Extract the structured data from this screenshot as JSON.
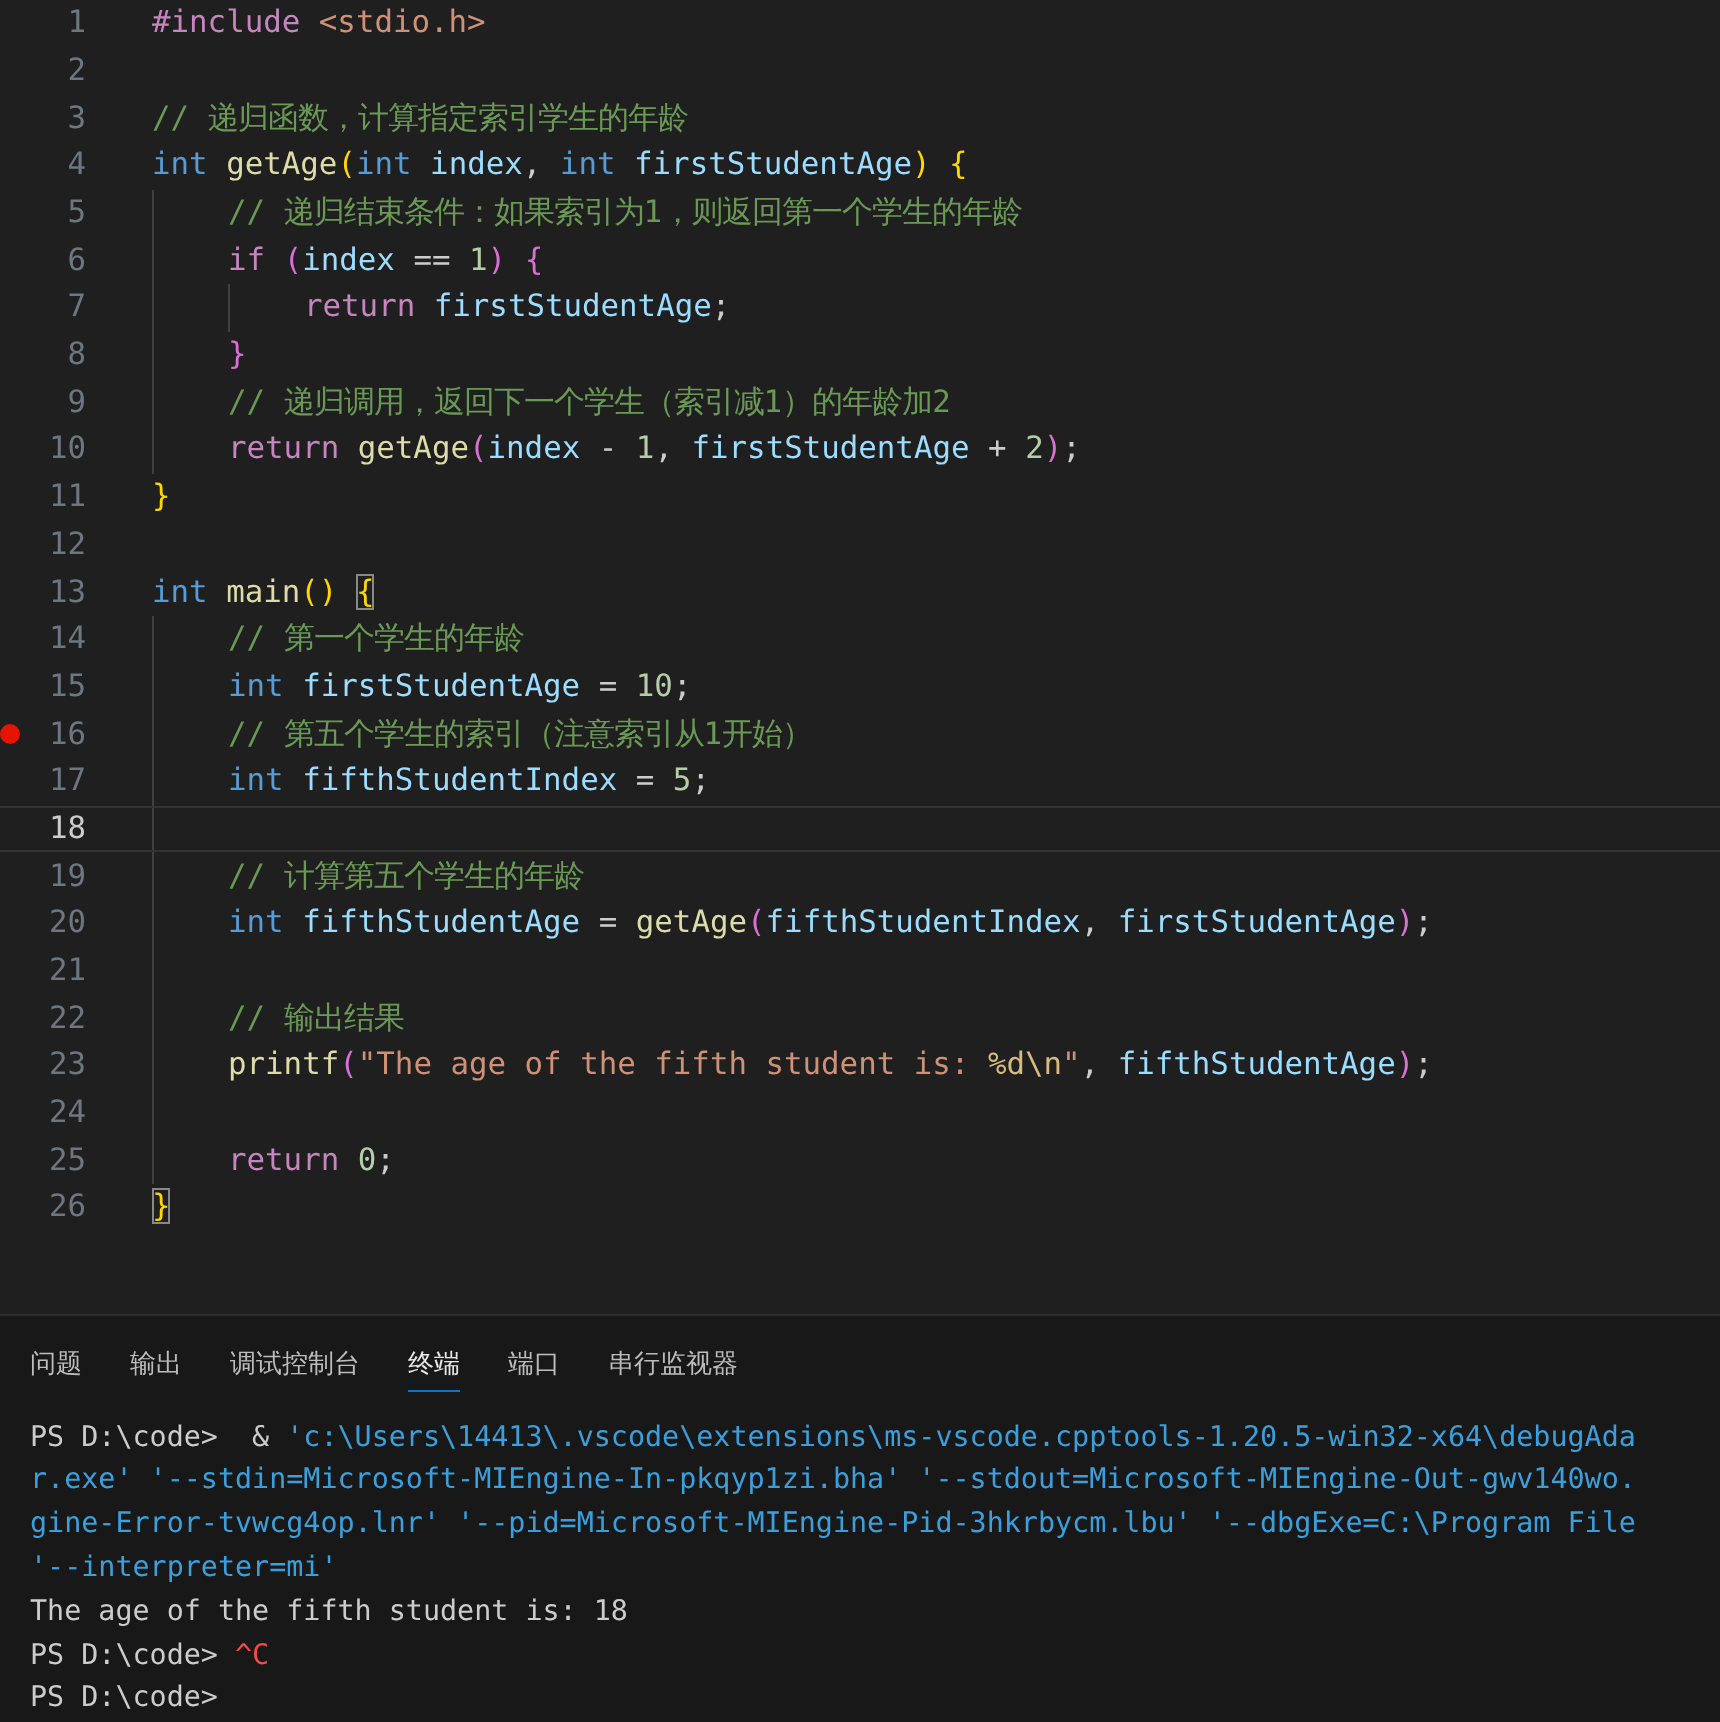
{
  "editor": {
    "lines": [
      {
        "number": "1",
        "breakpoint": false,
        "current": false,
        "tokens": [
          {
            "text": "#include ",
            "kind": "preproc"
          },
          {
            "text": "<stdio.h>",
            "kind": "string"
          }
        ]
      },
      {
        "number": "2",
        "breakpoint": false,
        "current": false
      },
      {
        "number": "3",
        "breakpoint": false,
        "current": false,
        "tokens": [
          {
            "text": "// 递归函数，计算指定索引学生的年龄",
            "kind": "comment"
          }
        ]
      },
      {
        "number": "4",
        "breakpoint": false,
        "current": false,
        "tokens": [
          {
            "text": "int ",
            "kind": "keyword"
          },
          {
            "text": "getAge",
            "kind": "function"
          },
          {
            "text": "(",
            "kind": "bracket1"
          },
          {
            "text": "int ",
            "kind": "keyword"
          },
          {
            "text": "index",
            "kind": "variable"
          },
          {
            "text": ", ",
            "kind": "plain"
          },
          {
            "text": "int ",
            "kind": "keyword"
          },
          {
            "text": "firstStudentAge",
            "kind": "variable"
          },
          {
            "text": ") {",
            "kind": "bracket1"
          }
        ]
      },
      {
        "number": "5",
        "breakpoint": false,
        "current": false,
        "tokens": [
          {
            "kind": "indent"
          },
          {
            "text": "// 递归结束条件：如果索引为1，则返回第一个学生的年龄",
            "kind": "comment"
          }
        ]
      },
      {
        "number": "6",
        "breakpoint": false,
        "current": false,
        "tokens": [
          {
            "kind": "indent"
          },
          {
            "text": "if ",
            "kind": "control"
          },
          {
            "text": "(",
            "kind": "bracket2"
          },
          {
            "text": "index",
            "kind": "variable"
          },
          {
            "text": " == ",
            "kind": "plain"
          },
          {
            "text": "1",
            "kind": "number"
          },
          {
            "text": ") {",
            "kind": "bracket2"
          }
        ]
      },
      {
        "number": "7",
        "breakpoint": false,
        "current": false,
        "tokens": [
          {
            "kind": "indent"
          },
          {
            "kind": "indent"
          },
          {
            "text": "return ",
            "kind": "control"
          },
          {
            "text": "firstStudentAge",
            "kind": "variable"
          },
          {
            "text": ";",
            "kind": "plain"
          }
        ]
      },
      {
        "number": "8",
        "breakpoint": false,
        "current": false,
        "tokens": [
          {
            "kind": "indent"
          },
          {
            "text": "}",
            "kind": "bracket2"
          }
        ]
      },
      {
        "number": "9",
        "breakpoint": false,
        "current": false,
        "tokens": [
          {
            "kind": "indent"
          },
          {
            "text": "// 递归调用，返回下一个学生（索引减1）的年龄加2",
            "kind": "comment"
          }
        ]
      },
      {
        "number": "10",
        "breakpoint": false,
        "current": false,
        "tokens": [
          {
            "kind": "indent"
          },
          {
            "text": "return ",
            "kind": "control"
          },
          {
            "text": "getAge",
            "kind": "function"
          },
          {
            "text": "(",
            "kind": "bracket2"
          },
          {
            "text": "index",
            "kind": "variable"
          },
          {
            "text": " - ",
            "kind": "plain"
          },
          {
            "text": "1",
            "kind": "number"
          },
          {
            "text": ", ",
            "kind": "plain"
          },
          {
            "text": "firstStudentAge",
            "kind": "variable"
          },
          {
            "text": " + ",
            "kind": "plain"
          },
          {
            "text": "2",
            "kind": "number"
          },
          {
            "text": ")",
            "kind": "bracket2"
          },
          {
            "text": ";",
            "kind": "plain"
          }
        ]
      },
      {
        "number": "11",
        "breakpoint": false,
        "current": false,
        "tokens": [
          {
            "text": "}",
            "kind": "bracket1"
          }
        ]
      },
      {
        "number": "12",
        "breakpoint": false,
        "current": false
      },
      {
        "number": "13",
        "breakpoint": false,
        "current": false,
        "tokens": [
          {
            "text": "int ",
            "kind": "keyword"
          },
          {
            "text": "main",
            "kind": "function"
          },
          {
            "text": "() ",
            "kind": "bracket1"
          },
          {
            "text": "{",
            "kind": "bracket1_matched"
          }
        ]
      },
      {
        "number": "14",
        "breakpoint": false,
        "current": false,
        "tokens": [
          {
            "kind": "indent"
          },
          {
            "text": "// 第一个学生的年龄",
            "kind": "comment"
          }
        ]
      },
      {
        "number": "15",
        "breakpoint": false,
        "current": false,
        "tokens": [
          {
            "kind": "indent"
          },
          {
            "text": "int ",
            "kind": "keyword"
          },
          {
            "text": "firstStudentAge",
            "kind": "variable"
          },
          {
            "text": " = ",
            "kind": "plain"
          },
          {
            "text": "10",
            "kind": "number"
          },
          {
            "text": ";",
            "kind": "plain"
          }
        ]
      },
      {
        "number": "16",
        "breakpoint": true,
        "current": false,
        "tokens": [
          {
            "kind": "indent"
          },
          {
            "text": "// 第五个学生的索引（注意索引从1开始）",
            "kind": "comment"
          }
        ]
      },
      {
        "number": "17",
        "breakpoint": false,
        "current": false,
        "tokens": [
          {
            "kind": "indent"
          },
          {
            "text": "int ",
            "kind": "keyword"
          },
          {
            "text": "fifthStudentIndex",
            "kind": "variable"
          },
          {
            "text": " = ",
            "kind": "plain"
          },
          {
            "text": "5",
            "kind": "number"
          },
          {
            "text": ";",
            "kind": "plain"
          }
        ]
      },
      {
        "number": "18",
        "breakpoint": false,
        "current": true,
        "tokens": [
          {
            "kind": "indent"
          }
        ]
      },
      {
        "number": "19",
        "breakpoint": false,
        "current": false,
        "tokens": [
          {
            "kind": "indent"
          },
          {
            "text": "// 计算第五个学生的年龄",
            "kind": "comment"
          }
        ]
      },
      {
        "number": "20",
        "breakpoint": false,
        "current": false,
        "tokens": [
          {
            "kind": "indent"
          },
          {
            "text": "int ",
            "kind": "keyword"
          },
          {
            "text": "fifthStudentAge",
            "kind": "variable"
          },
          {
            "text": " = ",
            "kind": "plain"
          },
          {
            "text": "getAge",
            "kind": "function"
          },
          {
            "text": "(",
            "kind": "bracket2"
          },
          {
            "text": "fifthStudentIndex",
            "kind": "variable"
          },
          {
            "text": ", ",
            "kind": "plain"
          },
          {
            "text": "firstStudentAge",
            "kind": "variable"
          },
          {
            "text": ")",
            "kind": "bracket2"
          },
          {
            "text": ";",
            "kind": "plain"
          }
        ]
      },
      {
        "number": "21",
        "breakpoint": false,
        "current": false,
        "tokens": [
          {
            "kind": "indent"
          }
        ]
      },
      {
        "number": "22",
        "breakpoint": false,
        "current": false,
        "tokens": [
          {
            "kind": "indent"
          },
          {
            "text": "// 输出结果",
            "kind": "comment"
          }
        ]
      },
      {
        "number": "23",
        "breakpoint": false,
        "current": false,
        "tokens": [
          {
            "kind": "indent"
          },
          {
            "text": "printf",
            "kind": "function"
          },
          {
            "text": "(",
            "kind": "bracket2"
          },
          {
            "text": "\"The age of the fifth student is: ",
            "kind": "string"
          },
          {
            "text": "%d\\n",
            "kind": "escape"
          },
          {
            "text": "\"",
            "kind": "string"
          },
          {
            "text": ", ",
            "kind": "plain"
          },
          {
            "text": "fifthStudentAge",
            "kind": "variable"
          },
          {
            "text": ")",
            "kind": "bracket2"
          },
          {
            "text": ";",
            "kind": "plain"
          }
        ]
      },
      {
        "number": "24",
        "breakpoint": false,
        "current": false,
        "tokens": [
          {
            "kind": "indent"
          }
        ]
      },
      {
        "number": "25",
        "breakpoint": false,
        "current": false,
        "tokens": [
          {
            "kind": "indent"
          },
          {
            "text": "return ",
            "kind": "control"
          },
          {
            "text": "0",
            "kind": "number"
          },
          {
            "text": ";",
            "kind": "plain"
          }
        ]
      },
      {
        "number": "26",
        "breakpoint": false,
        "current": false,
        "tokens": [
          {
            "text": "}",
            "kind": "bracket1_matched"
          }
        ]
      }
    ]
  },
  "panel": {
    "tabs": [
      {
        "label": "问题",
        "selected": false
      },
      {
        "label": "输出",
        "selected": false
      },
      {
        "label": "调试控制台",
        "selected": false
      },
      {
        "label": "终端",
        "selected": true
      },
      {
        "label": "端口",
        "selected": false
      },
      {
        "label": "串行监视器",
        "selected": false
      }
    ]
  },
  "terminal": {
    "lines": [
      [
        {
          "text": "PS D:\\code>  & ",
          "kind": "plain"
        },
        {
          "text": "'c:\\Users\\14413\\.vscode\\extensions\\ms-vscode.cpptools-1.20.5-win32-x64\\debugAda",
          "kind": "path"
        }
      ],
      [
        {
          "text": "r.exe' '--stdin=Microsoft-MIEngine-In-pkqyp1zi.bha' '--stdout=Microsoft-MIEngine-Out-gwv140wo.",
          "kind": "path"
        }
      ],
      [
        {
          "text": "gine-Error-tvwcg4op.lnr' '--pid=Microsoft-MIEngine-Pid-3hkrbycm.lbu' '--dbgExe=C:\\Program File",
          "kind": "path"
        }
      ],
      [
        {
          "text": "'--interpreter=mi'",
          "kind": "path"
        }
      ],
      [
        {
          "text": "The age of the fifth student is: 18",
          "kind": "plain"
        }
      ],
      [
        {
          "text": "PS D:\\code> ",
          "kind": "plain"
        },
        {
          "text": "^C",
          "kind": "error"
        }
      ],
      [
        {
          "text": "PS D:\\code>",
          "kind": "plain"
        }
      ]
    ]
  }
}
